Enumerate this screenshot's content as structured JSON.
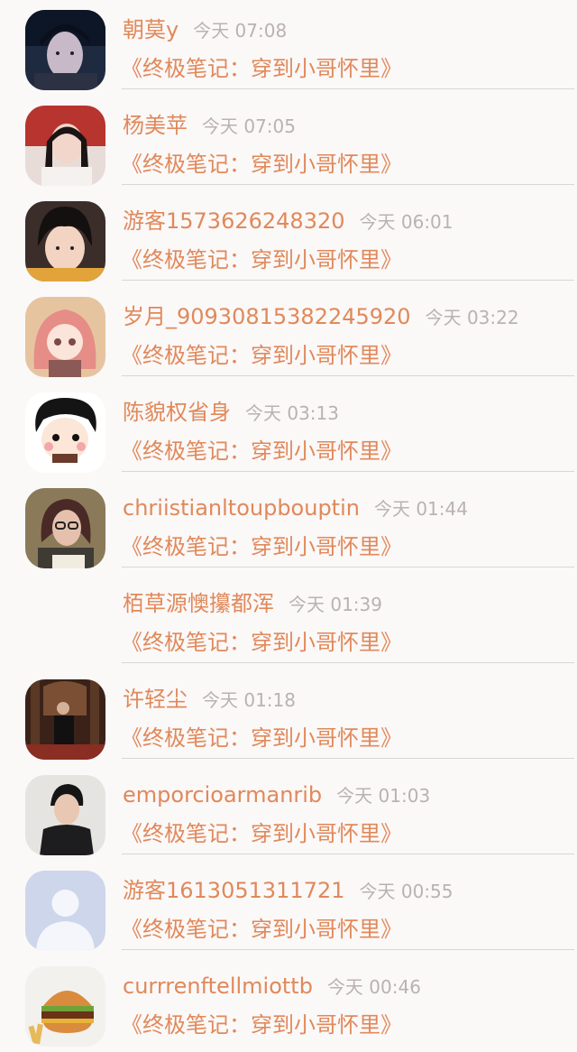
{
  "comments": [
    {
      "user": "朝莫y",
      "time": "今天 07:08",
      "book": "《终极笔记：穿到小哥怀里》",
      "avatar": "avatar-dark-portrait"
    },
    {
      "user": "杨美苹",
      "time": "今天 07:05",
      "book": "《终极笔记：穿到小哥怀里》",
      "avatar": "avatar-girl-red-scarf"
    },
    {
      "user": "游客1573626248320",
      "time": "今天 06:01",
      "book": "《终极笔记：穿到小哥怀里》",
      "avatar": "avatar-girl-bangs"
    },
    {
      "user": "岁月_90930815382245920",
      "time": "今天 03:22",
      "book": "《终极笔记：穿到小哥怀里》",
      "avatar": "avatar-anime-pink-hair"
    },
    {
      "user": "陈貌权省身",
      "time": "今天 03:13",
      "book": "《终极笔记：穿到小哥怀里》",
      "avatar": "avatar-cartoon-boy"
    },
    {
      "user": "chriistianltoupbouptin",
      "time": "今天 01:44",
      "book": "《终极笔记：穿到小哥怀里》",
      "avatar": "avatar-woman-glasses"
    },
    {
      "user": "栢草源懊攥都浑",
      "time": "今天 01:39",
      "book": "《终极笔记：穿到小哥怀里》",
      "avatar": "none"
    },
    {
      "user": "许轻尘",
      "time": "今天 01:18",
      "book": "《终极笔记：穿到小哥怀里》",
      "avatar": "avatar-man-in-hall"
    },
    {
      "user": "emporcioarmanrib",
      "time": "今天 01:03",
      "book": "《终极笔记：穿到小哥怀里》",
      "avatar": "avatar-young-man"
    },
    {
      "user": "游客1613051311721",
      "time": "今天 00:55",
      "book": "《终极笔记：穿到小哥怀里》",
      "avatar": "avatar-default-silhouette"
    },
    {
      "user": "currrenftellmiottb",
      "time": "今天 00:46",
      "book": "《终极笔记：穿到小哥怀里》",
      "avatar": "avatar-burger"
    }
  ],
  "colors": {
    "background": "#fbf8f8",
    "accent": "#e0895a",
    "time": "#b9b3b0",
    "divider": "#d9d6d6"
  }
}
